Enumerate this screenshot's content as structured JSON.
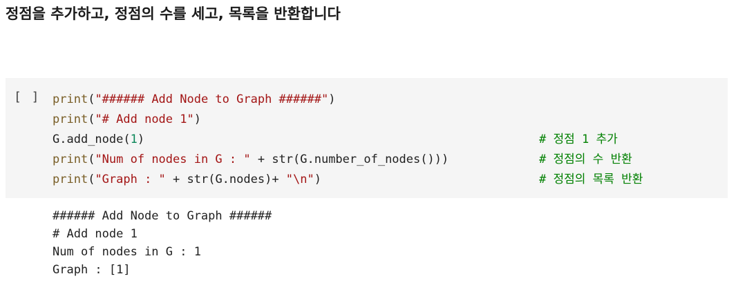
{
  "heading": "정점을 추가하고, 정점의 수를 세고, 목록을 반환합니다",
  "cell": {
    "prompt": "[ ]",
    "lines": [
      {
        "tokens": [
          {
            "t": "print",
            "c": "fn"
          },
          {
            "t": "(",
            "c": "pl"
          },
          {
            "t": "\"###### Add Node to Graph ######\"",
            "c": "st"
          },
          {
            "t": ")",
            "c": "pl"
          }
        ],
        "comment": ""
      },
      {
        "tokens": [
          {
            "t": "print",
            "c": "fn"
          },
          {
            "t": "(",
            "c": "pl"
          },
          {
            "t": "\"# Add node 1\"",
            "c": "st"
          },
          {
            "t": ")",
            "c": "pl"
          }
        ],
        "comment": ""
      },
      {
        "tokens": [
          {
            "t": "G.add_node(",
            "c": "pl"
          },
          {
            "t": "1",
            "c": "nm"
          },
          {
            "t": ")",
            "c": "pl"
          }
        ],
        "comment": "# 정점 1 추가"
      },
      {
        "tokens": [
          {
            "t": "print",
            "c": "fn"
          },
          {
            "t": "(",
            "c": "pl"
          },
          {
            "t": "\"Num of nodes in G : \"",
            "c": "st"
          },
          {
            "t": " + str(G.number_of_nodes()))",
            "c": "pl"
          }
        ],
        "comment": "# 정점의 수 반환"
      },
      {
        "tokens": [
          {
            "t": "print",
            "c": "fn"
          },
          {
            "t": "(",
            "c": "pl"
          },
          {
            "t": "\"Graph : \"",
            "c": "st"
          },
          {
            "t": " + str(G.nodes)+ ",
            "c": "pl"
          },
          {
            "t": "\"\\n\"",
            "c": "st"
          },
          {
            "t": ")",
            "c": "pl"
          }
        ],
        "comment": "# 정점의 목록 반환"
      }
    ]
  },
  "output": [
    "###### Add Node to Graph ######",
    "# Add node 1",
    "Num of nodes in G : 1",
    "Graph : [1]"
  ]
}
